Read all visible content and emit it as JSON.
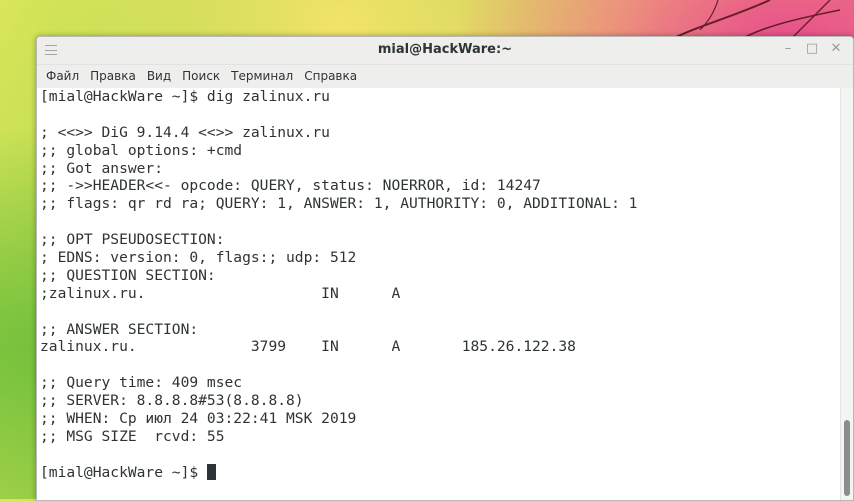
{
  "window": {
    "title": "mial@HackWare:~",
    "controls": {
      "minimize": "–",
      "maximize": "□",
      "close": "✕"
    }
  },
  "menu": [
    "Файл",
    "Правка",
    "Вид",
    "Поиск",
    "Терминал",
    "Справка"
  ],
  "terminal": {
    "lines": [
      "[mial@HackWare ~]$ dig zalinux.ru",
      "",
      "; <<>> DiG 9.14.4 <<>> zalinux.ru",
      ";; global options: +cmd",
      ";; Got answer:",
      ";; ->>HEADER<<- opcode: QUERY, status: NOERROR, id: 14247",
      ";; flags: qr rd ra; QUERY: 1, ANSWER: 1, AUTHORITY: 0, ADDITIONAL: 1",
      "",
      ";; OPT PSEUDOSECTION:",
      "; EDNS: version: 0, flags:; udp: 512",
      ";; QUESTION SECTION:",
      ";zalinux.ru.                    IN      A",
      "",
      ";; ANSWER SECTION:",
      "zalinux.ru.             3799    IN      A       185.26.122.38",
      "",
      ";; Query time: 409 msec",
      ";; SERVER: 8.8.8.8#53(8.8.8.8)",
      ";; WHEN: Ср июл 24 03:22:41 MSK 2019",
      ";; MSG SIZE  rcvd: 55",
      ""
    ],
    "prompt": "[mial@HackWare ~]$ "
  },
  "colors": {
    "terminal_bg": "#ffffff",
    "terminal_fg": "#2e3436",
    "titlebar": "#eeeeec"
  },
  "icons": {
    "menu": "hamburger-icon",
    "minimize": "minimize-icon",
    "maximize": "maximize-icon",
    "close": "close-icon"
  }
}
